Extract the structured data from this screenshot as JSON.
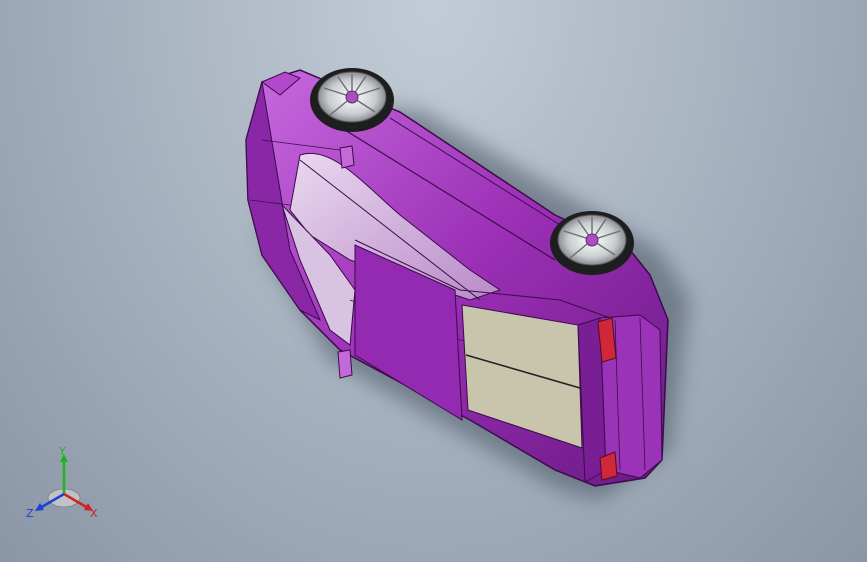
{
  "viewport": {
    "background_top": "#c3ccd6",
    "background_bottom": "#8a96a6"
  },
  "model": {
    "body_color": "#9b2fb5",
    "body_highlight": "#d98be8",
    "body_shadow": "#5c1573",
    "glass_color": "#d8c8e0",
    "rear_panel_color": "#c9c5ad",
    "tail_light_color": "#d0283a",
    "wheel_rim_color": "#d7dadd",
    "tire_color": "#1e1e1e"
  },
  "triad": {
    "y_label": "Y",
    "x_label": "X",
    "z_label": "Z",
    "y_color": "#18b818",
    "x_color": "#d42020",
    "z_color": "#2040d0"
  }
}
